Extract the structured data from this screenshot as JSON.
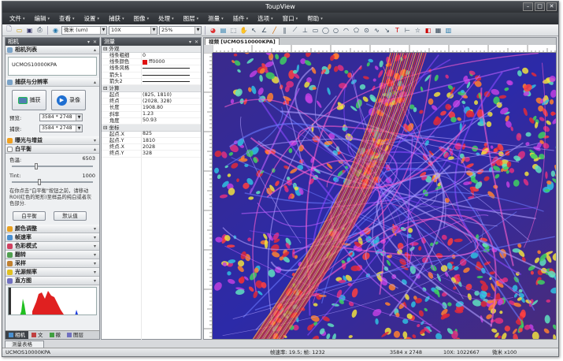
{
  "window": {
    "title": "ToupView"
  },
  "menu": [
    "文件",
    "编辑",
    "查看",
    "设置",
    "捕获",
    "图像",
    "处理",
    "图层",
    "测量",
    "插件",
    "选项",
    "窗口",
    "帮助"
  ],
  "toolbar": {
    "unit": "微米 (um)",
    "zoom": "10X",
    "percent": "25%"
  },
  "left": {
    "panel_title": "相机",
    "cam_list_title": "相机列表",
    "camera_name": "UCMOS10000KPA",
    "capture_title": "捕获与分辨率",
    "snap_label": "捕获",
    "record_label": "录像",
    "preview_label": "预览:",
    "preview_res": "3584 * 2748",
    "capture_label": "捕获:",
    "capture_res": "3584 * 2748",
    "exposure_title": "曝光与增益",
    "wb_title": "白平衡",
    "temp_label": "色温:",
    "temp_value": "6503",
    "tint_label": "Tint:",
    "tint_value": "1000",
    "wb_help": "在你点击\"白平衡\"按钮之前，请移动ROI(红色的矩形)至样品的纯白或者灰色部分.",
    "wb_button": "白平衡",
    "default_button": "默认值",
    "sections": [
      "颜色调整",
      "帧速率",
      "色彩模式",
      "翻转",
      "采样",
      "光源频率",
      "直方图"
    ],
    "tabs": [
      "相机",
      "文",
      "撤",
      "图层"
    ]
  },
  "measure": {
    "title": "测量",
    "rows": [
      {
        "group": "外观"
      },
      {
        "k": "线条粗细",
        "v": "0"
      },
      {
        "k": "线条颜色",
        "v": "ff0000",
        "swatch": "#e01010"
      },
      {
        "k": "线条风格",
        "v": "",
        "line": true
      },
      {
        "k": "箭头1",
        "v": "",
        "line": true
      },
      {
        "k": "箭头2",
        "v": "",
        "line": true
      },
      {
        "group": "计算"
      },
      {
        "k": "起点",
        "v": "(825, 1810)"
      },
      {
        "k": "终点",
        "v": "(2028, 328)"
      },
      {
        "k": "长度",
        "v": "1908.80"
      },
      {
        "k": "斜率",
        "v": "1.23"
      },
      {
        "k": "角度",
        "v": "50.93"
      },
      {
        "group": "坐标"
      },
      {
        "k": "起点.X",
        "v": "825"
      },
      {
        "k": "起点.Y",
        "v": "1810"
      },
      {
        "k": "终点.X",
        "v": "2028"
      },
      {
        "k": "终点.Y",
        "v": "328"
      }
    ]
  },
  "view": {
    "tab_label": "视频 [UCMOS10000KPA]"
  },
  "bottom_tab": "测量表格",
  "status": {
    "left": "UCMOS10000KPA",
    "fps": "帧速率: 19.5; 帧: 1232",
    "res": "3584 x 2748",
    "zoom": "10X: 1022667",
    "unit": "微米 x100"
  }
}
